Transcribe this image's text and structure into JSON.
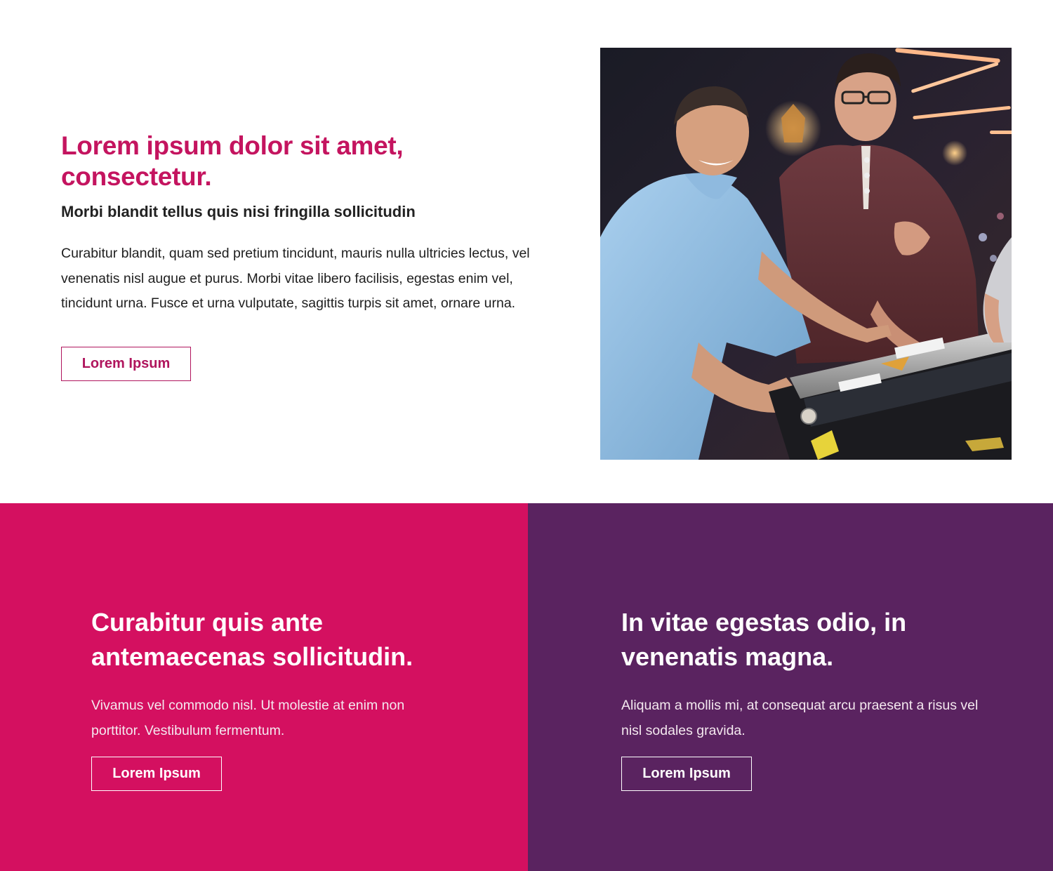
{
  "intro": {
    "heading": "Lorem ipsum dolor sit amet, consectetur.",
    "subheading": "Morbi blandit tellus quis nisi fringilla sollicitudin",
    "body": "Curabitur blandit, quam sed pretium tincidunt, mauris nulla ultricies lectus, vel venenatis nisl augue et purus. Morbi vitae libero facilisis, egestas enim vel, tincidunt urna. Fusce et urna vulputate, sagittis turpis sit amet, ornare urna.",
    "button_label": "Lorem Ipsum"
  },
  "photo": {
    "icon": "photo-pinball-players"
  },
  "panels": [
    {
      "heading": "Curabitur quis ante antemaecenas sollicitudin.",
      "body": "Vivamus vel commodo nisl. Ut molestie at enim non porttitor. Vestibulum fermentum.",
      "button_label": "Lorem Ipsum",
      "background": "#d41060"
    },
    {
      "heading": "In vitae egestas odio, in venenatis magna.",
      "body": "Aliquam a mollis mi, at consequat arcu praesent a risus vel nisl sodales gravida.",
      "button_label": "Lorem Ipsum",
      "background": "#5a2360"
    }
  ],
  "colors": {
    "accent_pink": "#c4145f",
    "panel_pink": "#d41060",
    "panel_purple": "#5a2360"
  }
}
